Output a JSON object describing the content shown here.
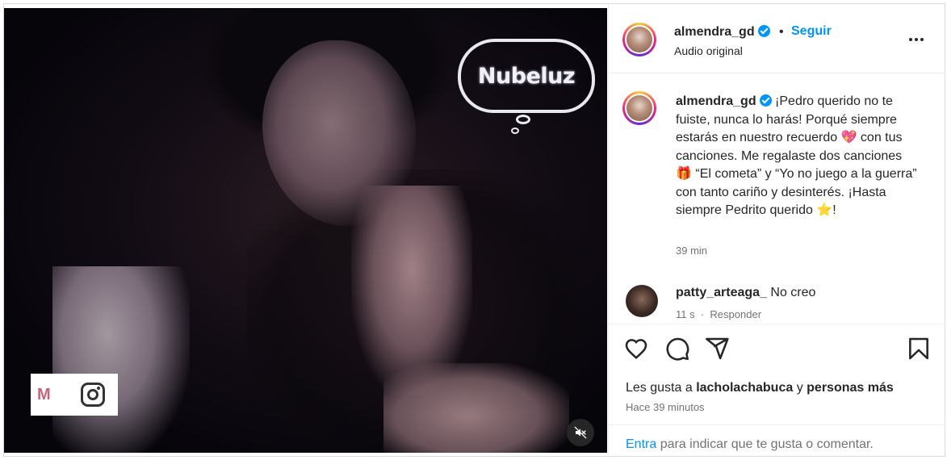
{
  "media": {
    "logo_text": "Nubeluz",
    "watermark_letter": "M"
  },
  "header": {
    "username": "almendra_gd",
    "separator": "•",
    "follow_label": "Seguir",
    "audio": "Audio original"
  },
  "caption": {
    "username": "almendra_gd",
    "text": "¡Pedro querido no te fuiste, nunca lo harás! Porqué siempre estarás en nuestro recuerdo 💖 con tus canciones. Me regalaste dos canciones 🎁 “El cometa” y “Yo no juego a la guerra” con tanto cariño y desinterés. ¡Hasta siempre Pedrito querido ⭐!",
    "time": "39 min"
  },
  "comments": [
    {
      "username": "patty_arteaga_",
      "text": "No creo",
      "time": "11 s",
      "reply_label": "Responder"
    }
  ],
  "likes": {
    "prefix": "Les gusta a",
    "user": "lacholachabuca",
    "conjunction": "y",
    "others": "personas más"
  },
  "post_time": "Hace 39 minutos",
  "add_comment": {
    "enter_label": "Entra",
    "rest": "para indicar que te gusta o comentar."
  },
  "colors": {
    "accent": "#0095f6",
    "text": "#262626",
    "muted": "#737373"
  }
}
